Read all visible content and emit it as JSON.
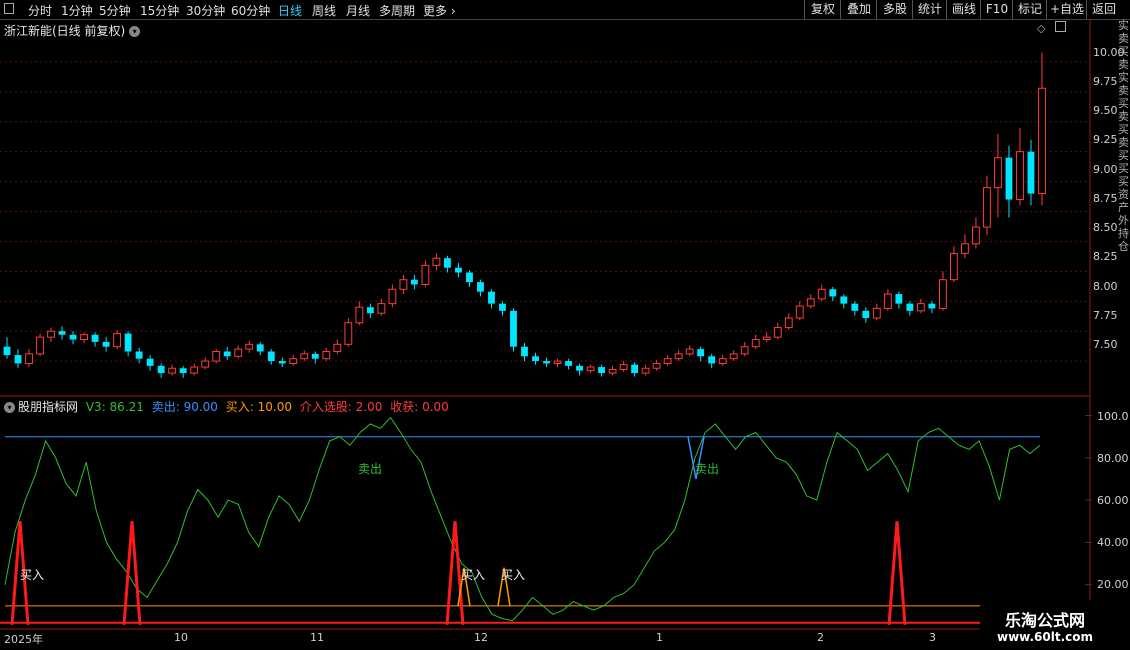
{
  "toolbar": {
    "periods": [
      "分时",
      "1分钟",
      "5分钟",
      "15分钟",
      "30分钟",
      "60分钟",
      "日线",
      "周线",
      "月线",
      "多周期",
      "更多"
    ],
    "active": "日线",
    "right_buttons": [
      "复权",
      "叠加",
      "多股",
      "统计",
      "画线",
      "F10",
      "标记",
      "+自选",
      "返回"
    ]
  },
  "header": {
    "stock_title": "浙江新能(日线 前复权)"
  },
  "indicator": {
    "name": "股朋指标网",
    "v3_label": "V3: 86.21",
    "sell_label": "卖出: 90.00",
    "buy_label": "买入: 10.00",
    "pick_label": "介入选股: 2.00",
    "harvest_label": "收获: 0.00",
    "sell_text": "卖出",
    "buy_text": "买入"
  },
  "colors": {
    "up": "#ff3b3b",
    "down": "#00e5ff",
    "sell_line": "#3a8fff",
    "buy_line": "#ff9900",
    "osc": "#2fbf2f",
    "spike": "#ff1a1a"
  },
  "price_axis": [
    "10.00",
    "9.75",
    "9.50",
    "9.25",
    "9.00",
    "8.75",
    "8.50",
    "8.25",
    "8.00",
    "7.75",
    "7.50"
  ],
  "ind_axis": [
    "100.0",
    "80.00",
    "60.00",
    "40.00",
    "20.00"
  ],
  "dates": [
    "2025年",
    "10",
    "11",
    "12",
    "1",
    "2",
    "3"
  ],
  "right_strip_text": "实卖买卖实卖买卖买卖买买买资产外持仓",
  "watermark": {
    "title": "乐淘公式网",
    "url": "www.60lt.com"
  },
  "chart_data": {
    "type": "candlestick",
    "y_range": [
      7.3,
      10.2
    ],
    "candles": [
      [
        7.62,
        7.55,
        7.7,
        7.52
      ],
      [
        7.55,
        7.48,
        7.6,
        7.44
      ],
      [
        7.48,
        7.56,
        7.6,
        7.45
      ],
      [
        7.56,
        7.7,
        7.73,
        7.54
      ],
      [
        7.7,
        7.75,
        7.78,
        7.66
      ],
      [
        7.75,
        7.72,
        7.79,
        7.68
      ],
      [
        7.72,
        7.68,
        7.75,
        7.64
      ],
      [
        7.68,
        7.72,
        7.74,
        7.65
      ],
      [
        7.72,
        7.66,
        7.74,
        7.62
      ],
      [
        7.66,
        7.62,
        7.7,
        7.58
      ],
      [
        7.62,
        7.73,
        7.76,
        7.6
      ],
      [
        7.73,
        7.58,
        7.75,
        7.54
      ],
      [
        7.58,
        7.52,
        7.61,
        7.48
      ],
      [
        7.52,
        7.46,
        7.55,
        7.42
      ],
      [
        7.46,
        7.4,
        7.48,
        7.36
      ],
      [
        7.4,
        7.44,
        7.47,
        7.38
      ],
      [
        7.44,
        7.4,
        7.46,
        7.36
      ],
      [
        7.4,
        7.45,
        7.48,
        7.38
      ],
      [
        7.45,
        7.5,
        7.53,
        7.43
      ],
      [
        7.5,
        7.58,
        7.6,
        7.48
      ],
      [
        7.58,
        7.54,
        7.62,
        7.51
      ],
      [
        7.54,
        7.6,
        7.63,
        7.52
      ],
      [
        7.6,
        7.64,
        7.67,
        7.57
      ],
      [
        7.64,
        7.58,
        7.66,
        7.55
      ],
      [
        7.58,
        7.5,
        7.6,
        7.47
      ],
      [
        7.5,
        7.48,
        7.53,
        7.45
      ],
      [
        7.48,
        7.52,
        7.55,
        7.46
      ],
      [
        7.52,
        7.56,
        7.59,
        7.5
      ],
      [
        7.56,
        7.52,
        7.58,
        7.48
      ],
      [
        7.52,
        7.58,
        7.61,
        7.5
      ],
      [
        7.58,
        7.64,
        7.68,
        7.56
      ],
      [
        7.64,
        7.82,
        7.86,
        7.62
      ],
      [
        7.82,
        7.95,
        8.0,
        7.8
      ],
      [
        7.95,
        7.9,
        7.98,
        7.86
      ],
      [
        7.9,
        7.98,
        8.02,
        7.88
      ],
      [
        7.98,
        8.1,
        8.14,
        7.95
      ],
      [
        8.1,
        8.18,
        8.22,
        8.06
      ],
      [
        8.18,
        8.14,
        8.22,
        8.1
      ],
      [
        8.14,
        8.3,
        8.34,
        8.12
      ],
      [
        8.3,
        8.36,
        8.4,
        8.26
      ],
      [
        8.36,
        8.28,
        8.38,
        8.24
      ],
      [
        8.28,
        8.24,
        8.32,
        8.2
      ],
      [
        8.24,
        8.16,
        8.26,
        8.12
      ],
      [
        8.16,
        8.08,
        8.18,
        8.04
      ],
      [
        8.08,
        7.98,
        8.1,
        7.94
      ],
      [
        7.98,
        7.92,
        8.0,
        7.88
      ],
      [
        7.92,
        7.62,
        7.94,
        7.58
      ],
      [
        7.62,
        7.54,
        7.65,
        7.5
      ],
      [
        7.54,
        7.5,
        7.57,
        7.47
      ],
      [
        7.5,
        7.48,
        7.53,
        7.45
      ],
      [
        7.48,
        7.5,
        7.52,
        7.45
      ],
      [
        7.5,
        7.46,
        7.52,
        7.43
      ],
      [
        7.46,
        7.42,
        7.48,
        7.38
      ],
      [
        7.42,
        7.45,
        7.47,
        7.4
      ],
      [
        7.45,
        7.4,
        7.47,
        7.37
      ],
      [
        7.4,
        7.43,
        7.46,
        7.38
      ],
      [
        7.43,
        7.47,
        7.5,
        7.41
      ],
      [
        7.47,
        7.4,
        7.49,
        7.37
      ],
      [
        7.4,
        7.44,
        7.47,
        7.38
      ],
      [
        7.44,
        7.48,
        7.51,
        7.42
      ],
      [
        7.48,
        7.52,
        7.55,
        7.46
      ],
      [
        7.52,
        7.56,
        7.59,
        7.5
      ],
      [
        7.56,
        7.6,
        7.63,
        7.54
      ],
      [
        7.6,
        7.54,
        7.62,
        7.5
      ],
      [
        7.54,
        7.48,
        7.56,
        7.44
      ],
      [
        7.48,
        7.52,
        7.55,
        7.46
      ],
      [
        7.52,
        7.56,
        7.59,
        7.5
      ],
      [
        7.56,
        7.62,
        7.66,
        7.54
      ],
      [
        7.62,
        7.68,
        7.72,
        7.6
      ],
      [
        7.68,
        7.7,
        7.74,
        7.66
      ],
      [
        7.7,
        7.78,
        7.82,
        7.68
      ],
      [
        7.78,
        7.86,
        7.9,
        7.76
      ],
      [
        7.86,
        7.96,
        8.0,
        7.84
      ],
      [
        7.96,
        8.02,
        8.06,
        7.94
      ],
      [
        8.02,
        8.1,
        8.14,
        8.0
      ],
      [
        8.1,
        8.04,
        8.12,
        8.0
      ],
      [
        8.04,
        7.98,
        8.06,
        7.94
      ],
      [
        7.98,
        7.92,
        8.0,
        7.88
      ],
      [
        7.92,
        7.86,
        7.95,
        7.82
      ],
      [
        7.86,
        7.94,
        7.98,
        7.84
      ],
      [
        7.94,
        8.06,
        8.1,
        7.92
      ],
      [
        8.06,
        7.98,
        8.08,
        7.94
      ],
      [
        7.98,
        7.92,
        8.0,
        7.88
      ],
      [
        7.92,
        7.98,
        8.02,
        7.9
      ],
      [
        7.98,
        7.94,
        8.0,
        7.9
      ],
      [
        7.94,
        8.18,
        8.25,
        7.92
      ],
      [
        8.18,
        8.4,
        8.46,
        8.16
      ],
      [
        8.4,
        8.48,
        8.56,
        8.36
      ],
      [
        8.48,
        8.62,
        8.7,
        8.44
      ],
      [
        8.62,
        8.95,
        9.05,
        8.55
      ],
      [
        8.95,
        9.2,
        9.4,
        8.7
      ],
      [
        9.2,
        8.85,
        9.3,
        8.7
      ],
      [
        8.85,
        9.25,
        9.45,
        8.8
      ],
      [
        9.25,
        8.9,
        9.35,
        8.8
      ],
      [
        8.9,
        9.78,
        10.08,
        8.8
      ]
    ],
    "osc_series": [
      20,
      45,
      60,
      72,
      88,
      80,
      68,
      62,
      78,
      55,
      40,
      32,
      26,
      18,
      14,
      22,
      30,
      40,
      55,
      65,
      60,
      52,
      60,
      58,
      45,
      38,
      52,
      62,
      58,
      50,
      60,
      75,
      88,
      90,
      86,
      92,
      96,
      94,
      99,
      92,
      84,
      78,
      64,
      52,
      40,
      30,
      26,
      14,
      6,
      4,
      3,
      8,
      14,
      10,
      6,
      8,
      12,
      10,
      8,
      10,
      14,
      16,
      20,
      28,
      36,
      40,
      46,
      60,
      80,
      92,
      96,
      90,
      84,
      90,
      92,
      86,
      80,
      78,
      72,
      62,
      60,
      78,
      92,
      88,
      84,
      74,
      78,
      82,
      74,
      64,
      88,
      92,
      94,
      90,
      86,
      84,
      88,
      76,
      60,
      84,
      86,
      82,
      86
    ],
    "sell_level": 90,
    "buy_level": 10,
    "spikes_at": [
      4,
      31,
      100,
      110,
      205
    ],
    "ind_y_range": [
      0,
      105
    ]
  }
}
